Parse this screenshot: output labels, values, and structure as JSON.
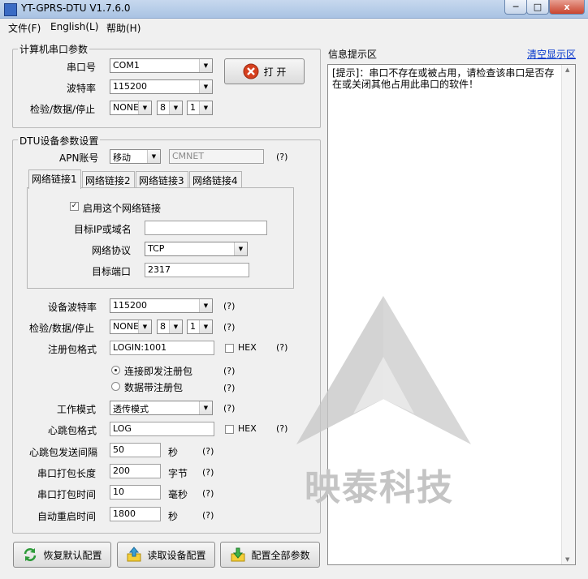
{
  "window": {
    "title": "YT-GPRS-DTU V1.7.6.0",
    "min": "─",
    "max": "□",
    "close": "x"
  },
  "menu": {
    "file": "文件(F)",
    "english": "English(L)",
    "help": "帮助(H)"
  },
  "serial": {
    "group_title": "计算机串口参数",
    "port_label": "串口号",
    "port_value": "COM1",
    "baud_label": "波特率",
    "baud_value": "115200",
    "check_label": "检验/数据/停止",
    "parity": "NONE",
    "databits": "8",
    "stopbits": "1",
    "open_button": "打 开"
  },
  "dtu": {
    "group_title": "DTU设备参数设置",
    "apn_label": "APN账号",
    "apn_value": "移动",
    "apn_text": "CMNET",
    "help_mark": "(?)",
    "tabs": [
      "网络链接1",
      "网络链接2",
      "网络链接3",
      "网络链接4"
    ],
    "enable_label": "启用这个网络链接",
    "ip_label": "目标IP或域名",
    "ip_value": "",
    "protocol_label": "网络协议",
    "protocol_value": "TCP",
    "port_label": "目标端口",
    "port_value": "2317",
    "dev_baud_label": "设备波特率",
    "dev_baud_value": "115200",
    "dev_check_label": "检验/数据/停止",
    "dev_parity": "NONE",
    "dev_databits": "8",
    "dev_stopbits": "1",
    "reg_label": "注册包格式",
    "reg_value": "LOGIN:1001",
    "hex_label": "HEX",
    "radio_connect": "连接即发注册包",
    "radio_data": "数据带注册包",
    "mode_label": "工作模式",
    "mode_value": "透传模式",
    "heartbeat_label": "心跳包格式",
    "heartbeat_value": "LOG",
    "hb_interval_label": "心跳包发送间隔",
    "hb_interval_value": "50",
    "unit_sec": "秒",
    "pack_len_label": "串口打包长度",
    "pack_len_value": "200",
    "unit_byte": "字节",
    "pack_time_label": "串口打包时间",
    "pack_time_value": "10",
    "unit_ms": "毫秒",
    "restart_label": "自动重启时间",
    "restart_value": "1800",
    "unit_sec2": "秒"
  },
  "buttons": {
    "restore": "恢复默认配置",
    "read": "读取设备配置",
    "write": "配置全部参数"
  },
  "info": {
    "label": "信息提示区",
    "clear": "清空显示区",
    "line1": "[提示]：串口不存在或被占用，请检查该串口是否存",
    "line2": "在或关闭其他占用此串口的软件！"
  },
  "watermark": {
    "text": "映泰科技"
  },
  "colors": {
    "accent": "#1f4fb3",
    "close_red": "#c9442e",
    "link": "#0033cc"
  }
}
